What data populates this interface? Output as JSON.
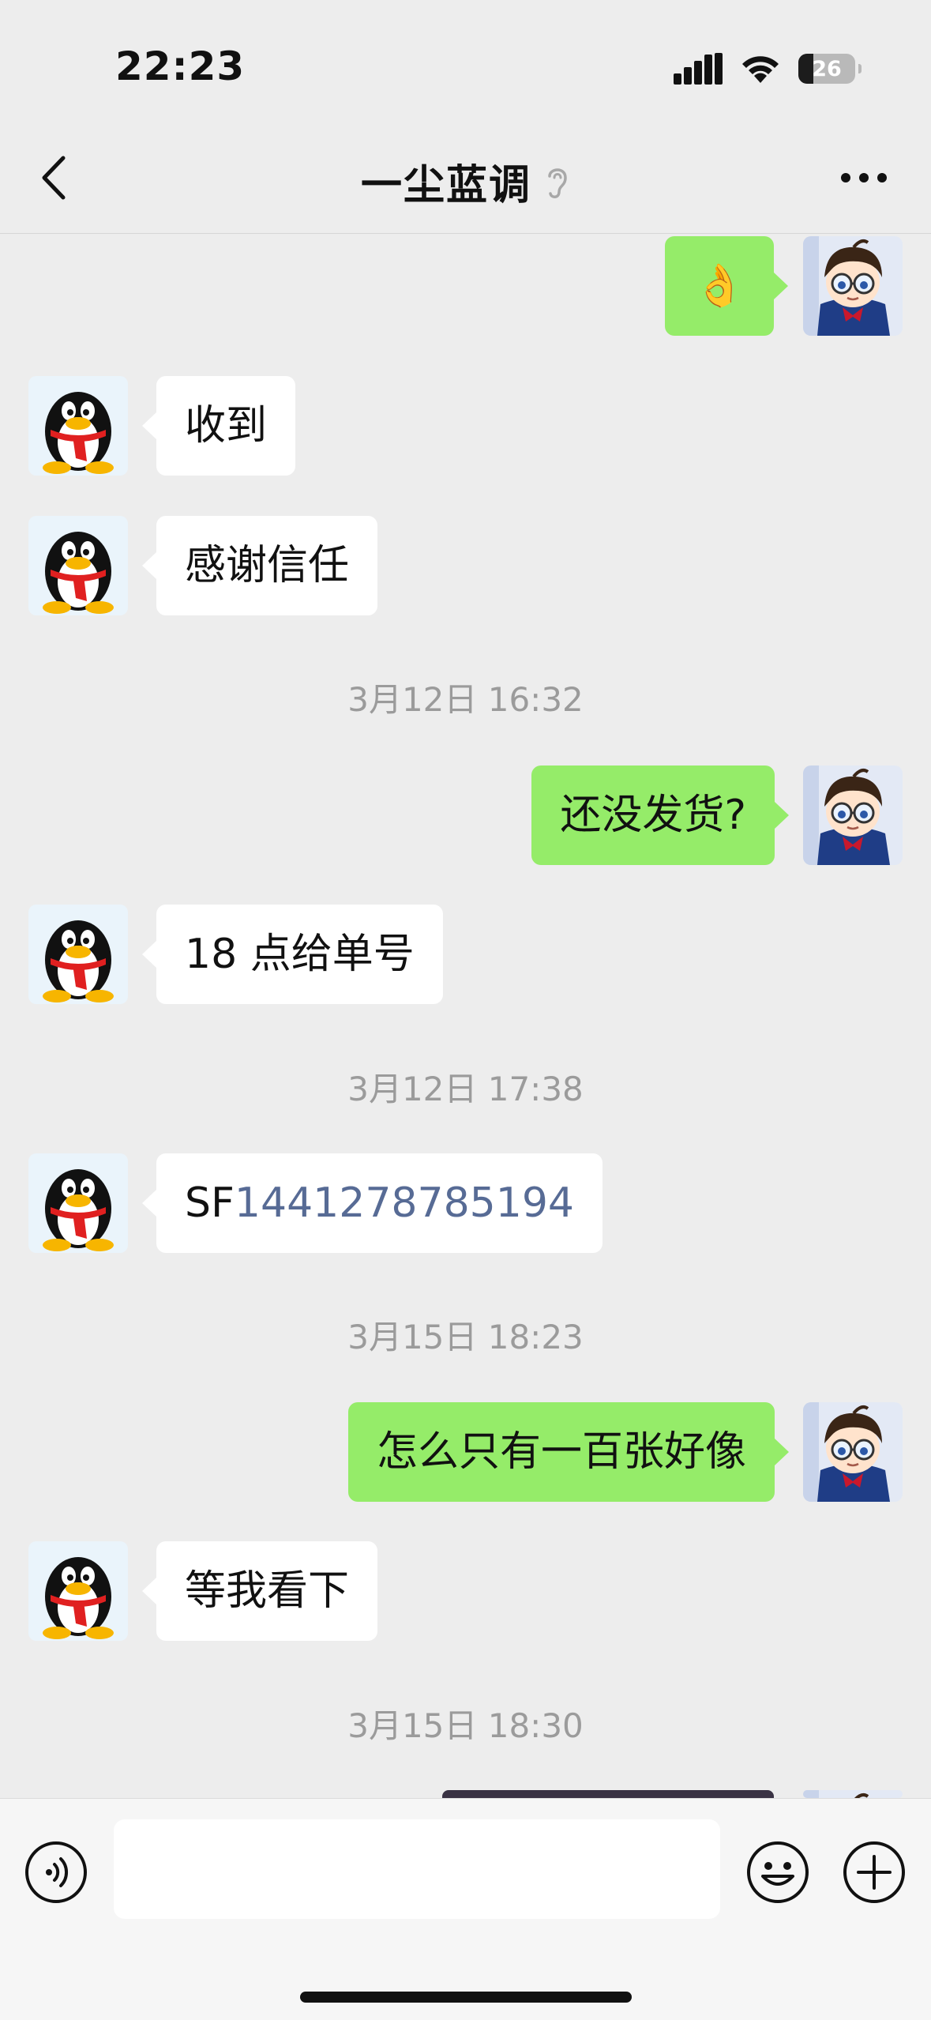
{
  "status_bar": {
    "time": "22:23",
    "battery_level": "26"
  },
  "nav": {
    "title": "一尘蓝调"
  },
  "messages": [
    {
      "side": "right",
      "text": "👌"
    },
    {
      "side": "left",
      "text": "收到"
    },
    {
      "side": "left",
      "text": "感谢信任"
    },
    {
      "timestamp": "3月12日 16:32"
    },
    {
      "side": "right",
      "text": "还没发货?"
    },
    {
      "side": "left",
      "text": "18 点给单号"
    },
    {
      "timestamp": "3月12日 17:38"
    },
    {
      "side": "left",
      "prefix": "SF",
      "link": "1441278785194"
    },
    {
      "timestamp": "3月15日 18:23"
    },
    {
      "side": "right",
      "text": "怎么只有一百张好像"
    },
    {
      "side": "left",
      "text": "等我看下"
    },
    {
      "timestamp": "3月15日 18:30"
    }
  ],
  "input": {
    "value": ""
  },
  "colors": {
    "background": "#ededed",
    "sent_bubble": "#95ec69",
    "received_bubble": "#ffffff",
    "link": "#576b95",
    "timestamp": "#9b9b9b"
  }
}
